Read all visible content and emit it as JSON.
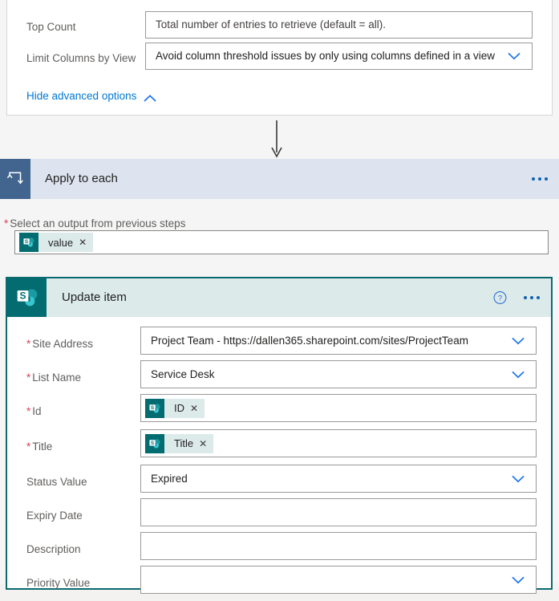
{
  "theme": {
    "page_bg": "#f5f5f5",
    "card_bg": "#ffffff",
    "accent_blue": "#0078d4",
    "link_blue": "#0f62b0",
    "required_red": "#d6405a",
    "sharepoint_teal": "#036c70",
    "sharepoint_chip_bg": "#dceaea",
    "apply_to_each_bar": "#dde4ef",
    "apply_to_each_icon_bg": "#41658e",
    "update_item_border": "#0b6a6f",
    "label_gray": "#605e5c",
    "input_border": "#9a9a9a"
  },
  "get_items_card": {
    "fields": [
      {
        "label": "Top Count",
        "required": false,
        "value": "Total number of entries to retrieve (default = all).",
        "is_placeholder": true,
        "has_chevron": false
      },
      {
        "label": "Limit Columns by View",
        "required": false,
        "value": "Avoid column threshold issues by only using columns defined in a view",
        "is_placeholder": false,
        "has_chevron": true,
        "chevron_icon": "chevron-down-icon"
      }
    ],
    "advanced_toggle": {
      "label": "Hide advanced options",
      "icon": "chevron-up-icon"
    }
  },
  "connector": {
    "icon": "down-arrow-icon"
  },
  "apply_to_each": {
    "title": "Apply to each",
    "icon": "loop-repeat-icon",
    "menu_icon": "ellipsis-icon",
    "output_field": {
      "label": "Select an output from previous steps",
      "required": true,
      "token": {
        "text": "value",
        "icon": "sharepoint-icon",
        "remove_icon": "close-icon"
      }
    }
  },
  "update_item": {
    "title": "Update item",
    "icon": "sharepoint-icon",
    "help_icon": "help-circle-icon",
    "menu_icon": "ellipsis-icon",
    "fields": [
      {
        "label": "Site Address",
        "required": true,
        "type": "dropdown",
        "value": "Project Team - https://dallen365.sharepoint.com/sites/ProjectTeam",
        "has_chevron": true,
        "chevron_icon": "chevron-down-icon"
      },
      {
        "label": "List Name",
        "required": true,
        "type": "dropdown",
        "value": "Service Desk",
        "has_chevron": true,
        "chevron_icon": "chevron-down-icon"
      },
      {
        "label": "Id",
        "required": true,
        "type": "token",
        "token": {
          "text": "ID",
          "icon": "sharepoint-icon",
          "remove_icon": "close-icon"
        },
        "has_chevron": false
      },
      {
        "label": "Title",
        "required": true,
        "type": "token",
        "token": {
          "text": "Title",
          "icon": "sharepoint-icon",
          "remove_icon": "close-icon"
        },
        "has_chevron": false
      },
      {
        "label": "Status Value",
        "required": false,
        "type": "dropdown",
        "value": "Expired",
        "has_chevron": true,
        "chevron_icon": "chevron-down-icon"
      },
      {
        "label": "Expiry Date",
        "required": false,
        "type": "text",
        "value": "",
        "has_chevron": false
      },
      {
        "label": "Description",
        "required": false,
        "type": "text",
        "value": "",
        "has_chevron": false
      },
      {
        "label": "Priority Value",
        "required": false,
        "type": "dropdown",
        "value": "",
        "has_chevron": true,
        "chevron_icon": "chevron-down-icon"
      }
    ]
  }
}
